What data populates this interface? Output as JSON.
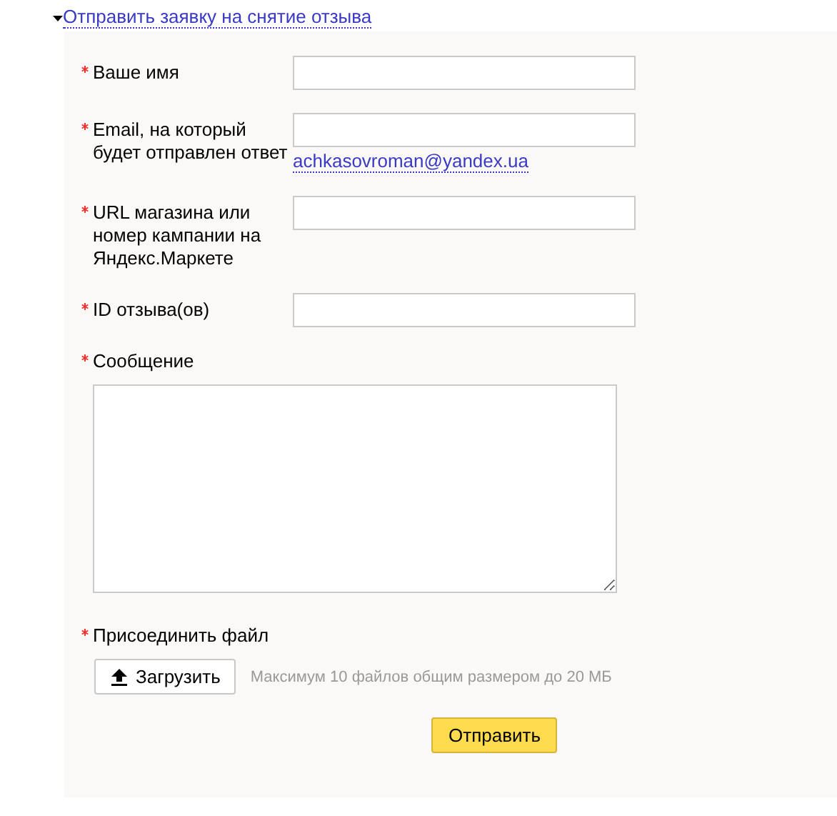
{
  "toggle": {
    "label": "Отправить заявку на снятие отзыва",
    "expanded": true
  },
  "fields": [
    {
      "kind": "text",
      "label": "Ваше имя",
      "required": true
    },
    {
      "kind": "text",
      "label": "Email, на который будет отправлен ответ",
      "required": true,
      "link": "achkasovroman@yandex.ua"
    },
    {
      "kind": "text",
      "label": "URL магазина или номер кампании на Яндекс.Маркете",
      "required": true
    },
    {
      "kind": "text",
      "label": "ID отзыва(ов)",
      "required": true
    },
    {
      "kind": "textarea",
      "label": "Сообщение",
      "required": true
    }
  ],
  "attachment": {
    "label": "Присоединить файл",
    "required": true,
    "button": "Загрузить",
    "note": "Максимум 10 файлов общим размером до 20 МБ"
  },
  "submit": "Отправить"
}
